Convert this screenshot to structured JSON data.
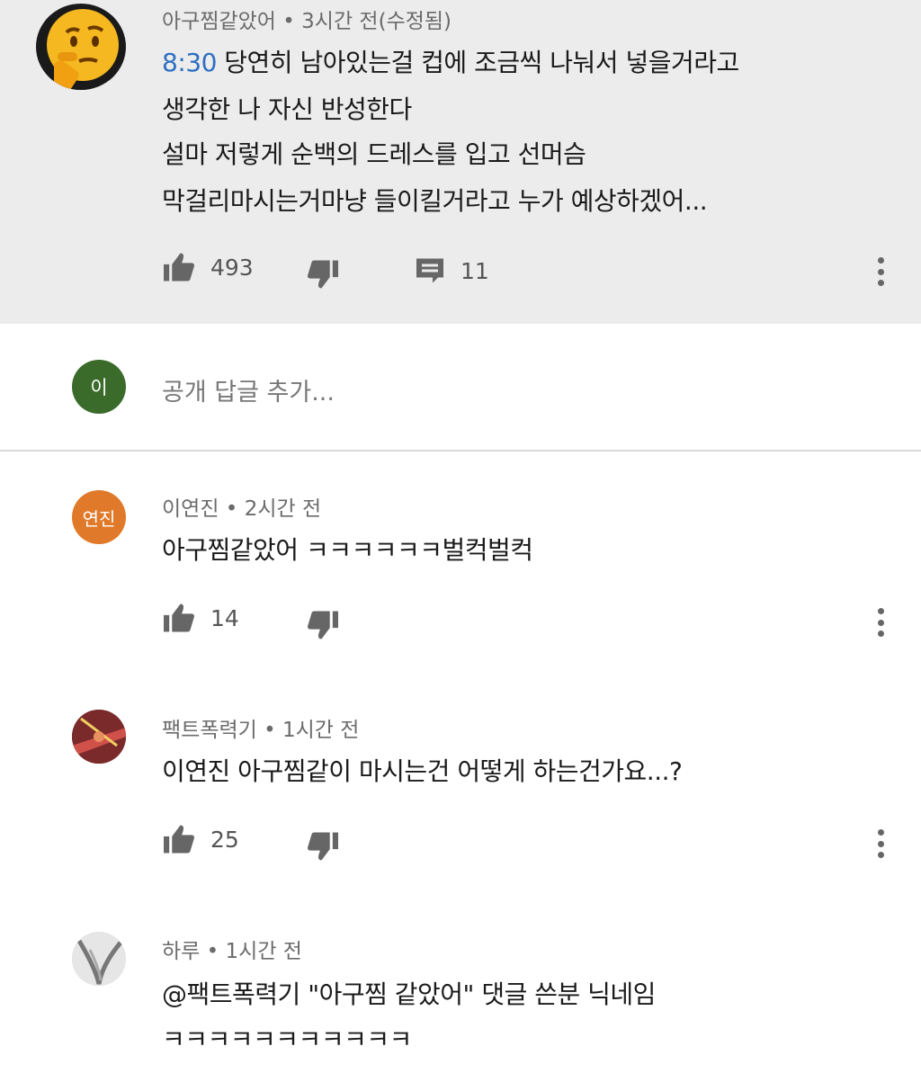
{
  "top_comment": {
    "author": "아구찜같았어",
    "time": "3시간 전(수정됨)",
    "timestamp_link": "8:30",
    "lines": [
      " 당연히 남아있는걸 컵에 조금씩 나눠서 넣을거라고",
      "생각한 나 자신 반성한다",
      "설마 저렇게 순백의 드레스를 입고 선머슴",
      "막걸리마시는거마냥 들이킬거라고 누가 예상하겠어..."
    ],
    "likes": "493",
    "replies": "11"
  },
  "reply_box": {
    "avatar_initial": "이",
    "placeholder": "공개 답글 추가..."
  },
  "replies": [
    {
      "author": "이연진",
      "time": "2시간 전",
      "avatar_text": "연진",
      "lines": [
        "아구찜같았어 ㅋㅋㅋㅋㅋㅋ벌컥벌컥"
      ],
      "likes": "14"
    },
    {
      "author": "팩트폭력기",
      "time": "1시간 전",
      "lines": [
        "이연진 아구찜같이 마시는건 어떻게 하는건가요...?"
      ],
      "likes": "25"
    },
    {
      "author": "하루",
      "time": "1시간 전",
      "lines": [
        "@팩트폭력기 \"아구찜 같았어\" 댓글 쓴분 닉네임",
        "ㅋㅋㅋㅋㅋㅋㅋㅋㅋㅋㅋ"
      ]
    }
  ],
  "icons": [
    "thumbs-up-icon",
    "thumbs-down-icon",
    "reply-comment-icon",
    "more-vert-icon"
  ],
  "colors": {
    "timestamp_link": "#2d6fc2",
    "highlight_bg": "#ececec",
    "reply_avatar": "#3a6b2a",
    "yeonjin_avatar": "#e07a2a"
  }
}
